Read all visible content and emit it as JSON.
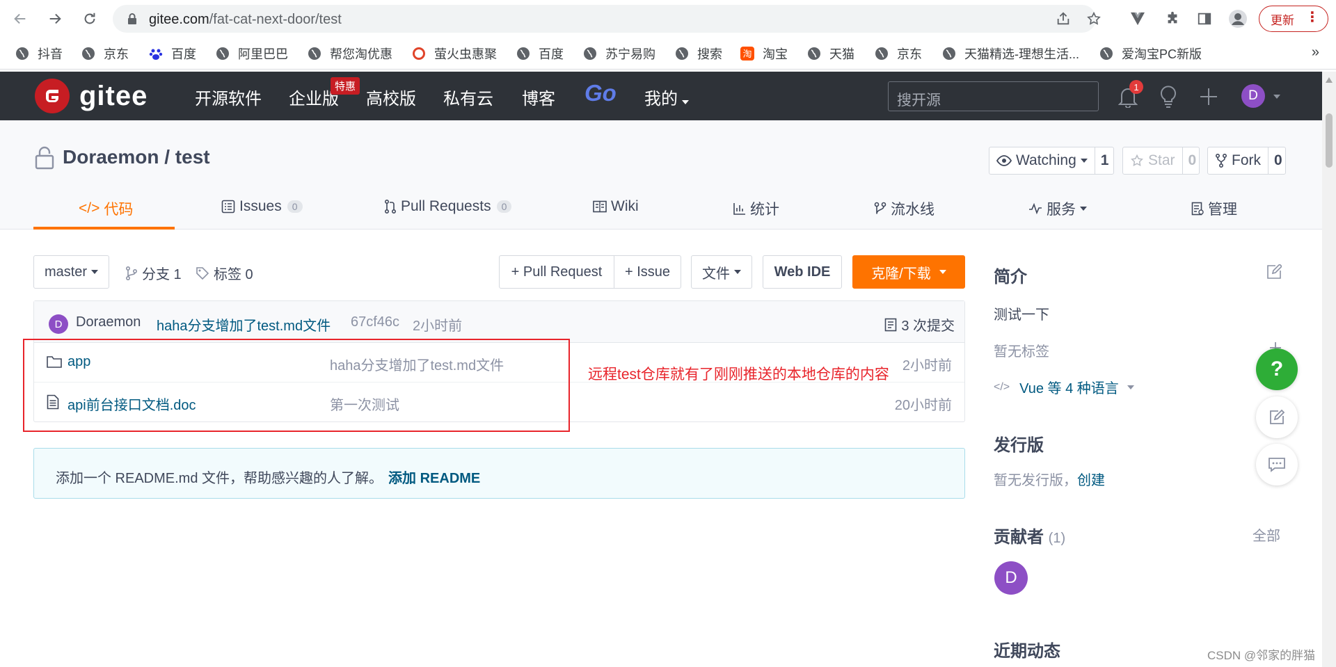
{
  "browser": {
    "url_host": "gitee.com",
    "url_path": "/fat-cat-next-door/test",
    "update_label": "更新",
    "bookmarks": [
      "抖音",
      "京东",
      "百度",
      "阿里巴巴",
      "帮您淘优惠",
      "萤火虫惠聚",
      "百度",
      "苏宁易购",
      "搜索",
      "淘宝",
      "天猫",
      "京东",
      "天猫精选-理想生活...",
      "爱淘宝PC新版"
    ],
    "bookmarks_more": "»"
  },
  "header": {
    "logo_text": "gitee",
    "nav": [
      "开源软件",
      "企业版",
      "高校版",
      "私有云",
      "博客"
    ],
    "promo_badge": "特惠",
    "go_label": "Go",
    "mine_label": "我的",
    "search_placeholder": "搜开源",
    "notification_count": "1",
    "avatar_letter": "D"
  },
  "repo": {
    "title": "Doraemon / test",
    "watching_label": "Watching",
    "watching_count": "1",
    "star_label": "Star",
    "star_count": "0",
    "fork_label": "Fork",
    "fork_count": "0",
    "tabs": {
      "code": "代码",
      "issues": "Issues",
      "issues_count": "0",
      "pulls": "Pull Requests",
      "pulls_count": "0",
      "wiki": "Wiki",
      "stats": "统计",
      "pipeline": "流水线",
      "services": "服务",
      "manage": "管理"
    }
  },
  "toolbar": {
    "branch": "master",
    "branches_label": "分支 1",
    "tags_label": "标签 0",
    "pull_request_btn": "+ Pull Request",
    "issue_btn": "+ Issue",
    "file_btn": "文件",
    "webide_btn": "Web IDE",
    "clone_btn": "克隆/下载"
  },
  "commit": {
    "avatar_letter": "D",
    "author": "Doraemon",
    "message": "haha分支增加了test.md文件",
    "hash": "67cf46c",
    "time": "2小时前",
    "commits_label": "3 次提交"
  },
  "files": [
    {
      "name": "app",
      "message": "haha分支增加了test.md文件",
      "time": "2小时前",
      "icon": "folder-icon"
    },
    {
      "name": "api前台接口文档.doc",
      "message": "第一次测试",
      "time": "20小时前",
      "icon": "file-icon"
    }
  ],
  "annotation": {
    "text": "远程test仓库就有了刚刚推送的本地仓库的内容",
    "color": "#e8242b"
  },
  "readme": {
    "text": "添加一个 README.md 文件，帮助感兴趣的人了解。",
    "link": "添加 README"
  },
  "sidebar": {
    "intro_title": "简介",
    "intro_desc": "测试一下",
    "no_tags": "暂无标签",
    "language": "Vue 等 4 种语言",
    "release_title": "发行版",
    "no_release": "暂无发行版，",
    "create_link": "创建",
    "contrib_title": "贡献者",
    "contrib_count": "(1)",
    "all_link": "全部",
    "contrib_avatar": "D",
    "activity_title": "近期动态"
  },
  "float": {
    "help": "?"
  },
  "watermark": "CSDN @邻家的胖猫",
  "colors": {
    "accent": "#fe7300",
    "header_bg": "#2e3238",
    "link": "#005980",
    "brand_red": "#c71d23"
  }
}
